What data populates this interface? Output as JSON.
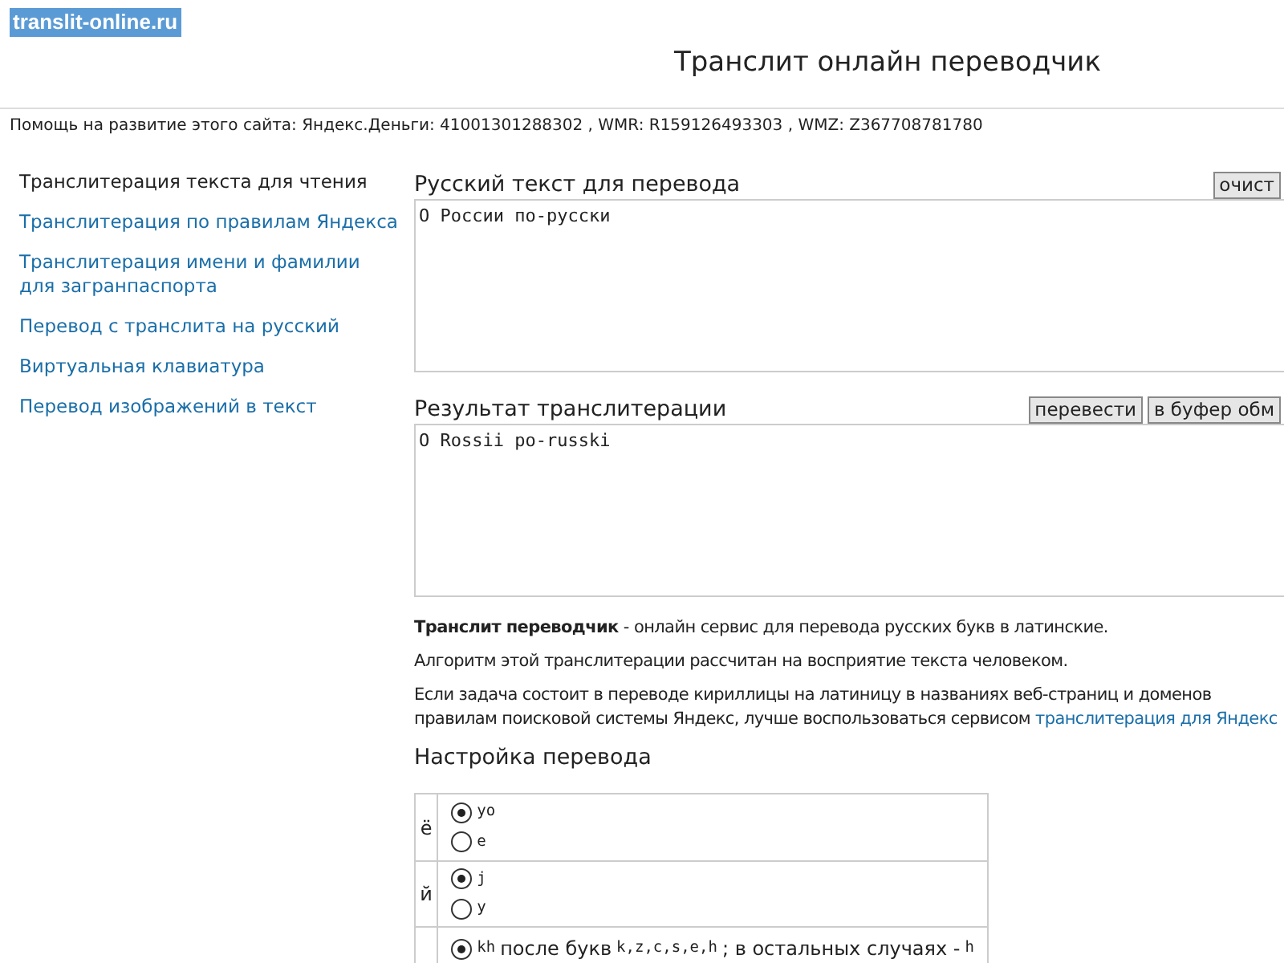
{
  "logo": "translit-online.ru",
  "title": "Транслит онлайн переводчик",
  "donate": "Помощь на развитие этого сайта: Яндекс.Деньги: 41001301288302 , WMR: R159126493303 , WMZ: Z367708781780",
  "sidebar": {
    "items": [
      {
        "label": "Транслитерация текста для чтения",
        "selected": true
      },
      {
        "label": "Транслитерация по правилам Яндекса",
        "selected": false
      },
      {
        "label": "Транслитерация имени и фамилии для загранпаспорта",
        "selected": false
      },
      {
        "label": "Перевод с транслита на русский",
        "selected": false
      },
      {
        "label": "Виртуальная клавиатура",
        "selected": false
      },
      {
        "label": "Перевод изображений в текст",
        "selected": false
      }
    ]
  },
  "input": {
    "label": "Русский текст для перевода",
    "value": "О России по-русски",
    "buttons": [
      "очист"
    ]
  },
  "output": {
    "label": "Результат транслитерации",
    "value": "O Rossii po-russki",
    "buttons": [
      "перевести",
      "в буфер обм"
    ]
  },
  "about": [
    {
      "text": "**Транслит переводчик** - онлайн сервис для перевода русских букв в латинские."
    },
    {
      "text": "Алгоритм этой транслитерации рассчитан на восприятие текста человеком."
    },
    {
      "text": "Если задача состоит в переводе кириллицы на латиницу в названиях веб-страниц и доменов",
      "text2": "правилам поисковой системы Яндекс, лучше воспользоваться сервисом",
      "link": "транслитерация для Яндекс"
    }
  ],
  "settings": {
    "title": "Настройка перевода",
    "rows": [
      {
        "letter": "ё",
        "options": [
          {
            "selected": true,
            "parts": [
              {
                "kind": "code",
                "text": "yo"
              }
            ]
          },
          {
            "selected": false,
            "parts": [
              {
                "kind": "code",
                "text": "e"
              }
            ]
          }
        ]
      },
      {
        "letter": "й",
        "options": [
          {
            "selected": true,
            "parts": [
              {
                "kind": "code",
                "text": "j"
              }
            ]
          },
          {
            "selected": false,
            "parts": [
              {
                "kind": "code",
                "text": "y"
              }
            ]
          }
        ]
      },
      {
        "options": [
          {
            "selected": true,
            "parts": [
              {
                "kind": "code",
                "text": "kh"
              },
              {
                "kind": "text",
                "text": "после букв"
              },
              {
                "kind": "code",
                "text": "k,z,c,s,e,h"
              },
              {
                "kind": "text",
                "text": "; в остальных случаях -"
              },
              {
                "kind": "code",
                "text": "h"
              }
            ]
          }
        ]
      }
    ]
  }
}
